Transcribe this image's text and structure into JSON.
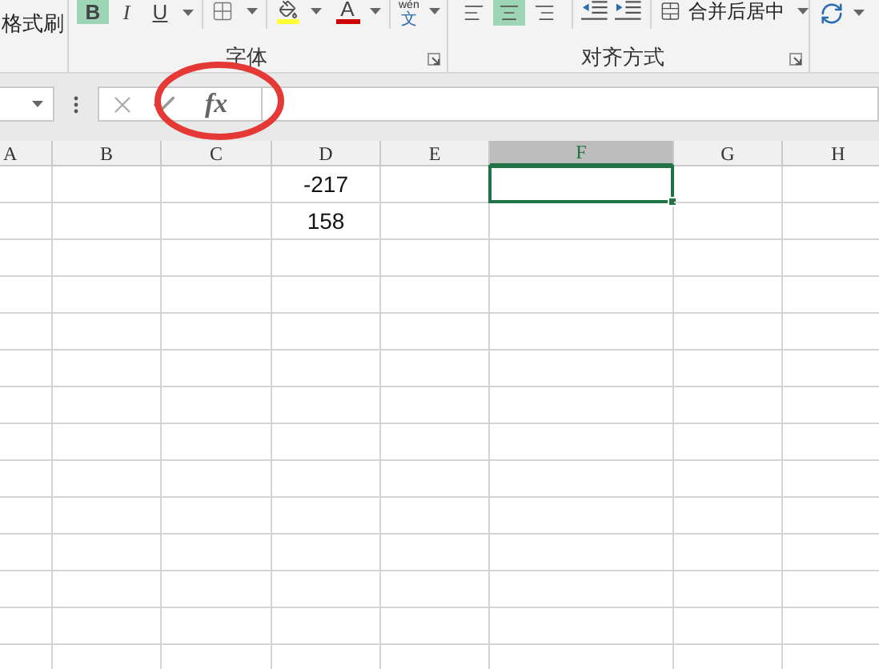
{
  "ribbon": {
    "clipboard": {
      "format_painter": "格式刷"
    },
    "font": {
      "label": "字体",
      "styles": [
        {
          "kind": "bold",
          "label": "B",
          "selected": true
        },
        {
          "kind": "italic",
          "label": "I",
          "selected": false
        },
        {
          "kind": "underline",
          "label": "U",
          "selected": false
        }
      ],
      "font_color": "A",
      "phonetic": {
        "top": "wén",
        "bottom": "文"
      }
    },
    "alignment": {
      "label": "对齐方式",
      "align": [
        {
          "kind": "left",
          "selected": false
        },
        {
          "kind": "center",
          "selected": true
        },
        {
          "kind": "right",
          "selected": false
        }
      ],
      "merge": "合并后居中"
    }
  },
  "formula_bar": {
    "function_button": "fx"
  },
  "sheet": {
    "columns": [
      {
        "label": "A",
        "selected": false
      },
      {
        "label": "B",
        "selected": false
      },
      {
        "label": "C",
        "selected": false
      },
      {
        "label": "D",
        "selected": false,
        "cells": [
          {
            "text": "-217",
            "selected": false
          },
          {
            "text": "158",
            "selected": false
          }
        ]
      },
      {
        "label": "E",
        "selected": false
      },
      {
        "label": "F",
        "selected": true,
        "cells": [
          {
            "selected": true
          }
        ]
      },
      {
        "label": "G",
        "selected": false
      },
      {
        "label": "H",
        "selected": false
      }
    ]
  }
}
